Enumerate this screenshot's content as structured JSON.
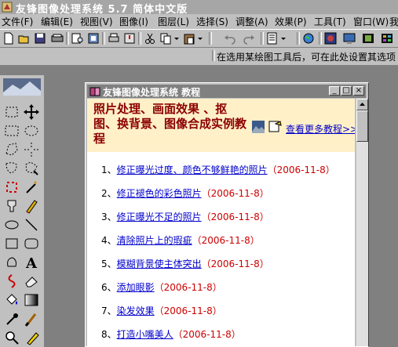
{
  "app": {
    "title": "友锋图像处理系统 5.7 简体中文版"
  },
  "menu": [
    "文件(F)",
    "编辑(E)",
    "视图(V)",
    "图像(I)",
    "图层(L)",
    "选择(S)",
    "调整(A)",
    "效果(P)",
    "工具(T)",
    "窗口(W)",
    "我"
  ],
  "hint": "在选用某绘图工具后，可在此处设置其选项",
  "tutorial": {
    "title": "友锋图像处理系统 教程",
    "heading": "照片处理、画面效果 、抠图、换背景、图像合成实例教程",
    "more_link": "查看更多教程>>>",
    "items": [
      {
        "num": "1、",
        "title": "修正曝光过度、颜色不够鲜艳的照片",
        "date": "（2006-11-8）"
      },
      {
        "num": "2、",
        "title": "修正褪色的彩色照片",
        "date": "（2006-11-8）"
      },
      {
        "num": "3、",
        "title": "修正曝光不足的照片",
        "date": "（2006-11-8）"
      },
      {
        "num": "4、",
        "title": "清除照片上的瑕疵",
        "date": "（2006-11-8）"
      },
      {
        "num": "5、",
        "title": "模糊背景使主体突出",
        "date": "（2006-11-8）"
      },
      {
        "num": "6、",
        "title": "添加眼影",
        "date": "（2006-11-8）"
      },
      {
        "num": "7、",
        "title": "染发效果",
        "date": "（2006-11-8）"
      },
      {
        "num": "8、",
        "title": "打造小嘴美人",
        "date": "（2006-11-8）"
      }
    ]
  },
  "toolbar_icons": [
    "new-icon",
    "open-icon",
    "save-icon",
    "scan-icon",
    "print-preview-icon",
    "cut-icon",
    "copy-icon",
    "paste-icon",
    "undo-icon",
    "redo-icon",
    "filter-icon",
    "globe-icon",
    "photo-icon",
    "monitor-icon",
    "film-icon"
  ],
  "tool_icons": [
    "rect-select-icon",
    "move-icon",
    "rect-marquee-icon",
    "ellipse-marquee-icon",
    "lasso-icon",
    "polygon-lasso-icon",
    "magnetic-lasso-icon",
    "magic-lasso-icon",
    "crop-icon",
    "magic-wand-icon",
    "stamp-icon",
    "pencil-icon",
    "ellipse-icon",
    "line-icon",
    "rectangle-icon",
    "rounded-rect-icon",
    "shape-icon",
    "text-icon",
    "path-icon",
    "eraser-icon",
    "fill-icon",
    "gradient-icon",
    "eyedropper-icon",
    "brush-icon",
    "zoom-icon",
    "highlighter-icon"
  ],
  "colors": {
    "title_gray": "#a6a6a6",
    "banner_bg": "#fff0c8",
    "heading": "#8b0000",
    "link": "#0000cc",
    "date": "#cc0000"
  }
}
